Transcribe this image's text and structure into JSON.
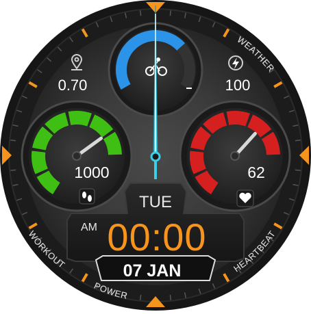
{
  "bezel": {
    "weather_label": "WEATHER",
    "workout_label": "WORKOUT",
    "power_label": "POWER",
    "heartbeat_label": "HEARTBEAT"
  },
  "complications": {
    "distance": {
      "value": "0.70",
      "icon": "location-pin-icon"
    },
    "battery": {
      "value": "100",
      "icon": "lightning-icon"
    },
    "steps": {
      "value": "1000",
      "icon": "footsteps-icon",
      "level": 0.85
    },
    "heart_rate": {
      "value": "62",
      "icon": "heart-icon",
      "level": 0.8
    },
    "top_gauge": {
      "icon": "cycling-icon",
      "level": 0.7
    }
  },
  "time": {
    "ampm": "AM",
    "value": "00:00",
    "day": "TUE",
    "date": "07 JAN"
  },
  "colors": {
    "accent_orange": "#f7941d",
    "blue": "#2b93e8",
    "green": "#3fbf14",
    "red": "#d62020",
    "hand_cyan": "#3ad0e8"
  }
}
